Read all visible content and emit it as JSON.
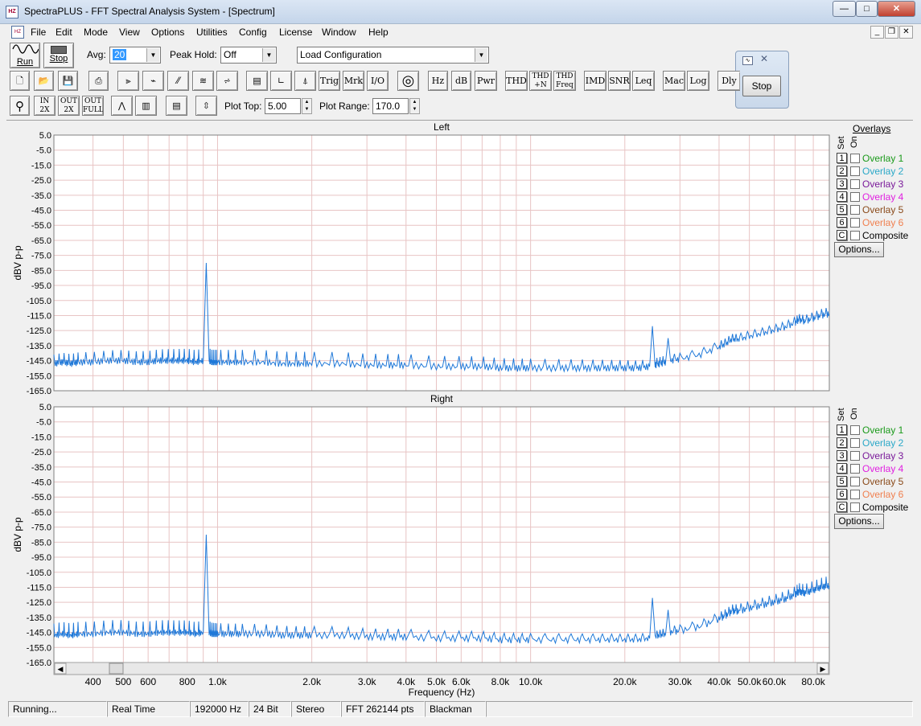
{
  "window": {
    "title": "SpectraPLUS - FFT Spectral Analysis System - [Spectrum]",
    "app_icon_text": "HZ"
  },
  "caption_buttons": {
    "minimize": "—",
    "maximize": "□",
    "close": "✕"
  },
  "menu": [
    "File",
    "Edit",
    "Mode",
    "View",
    "Options",
    "Utilities",
    "Config",
    "License",
    "Window",
    "Help"
  ],
  "mdi_buttons": {
    "minimize": "_",
    "restore": "❐",
    "close": "✕"
  },
  "toolbar1": {
    "run_label": "Run",
    "stop_label": "Stop",
    "avg_label": "Avg:",
    "avg_value": "20",
    "peak_hold_label": "Peak Hold:",
    "peak_hold_value": "Off",
    "config_value": "Load Configuration"
  },
  "toolbar2": [
    "Trig",
    "Mrk",
    "I/O",
    "Hz",
    "dB",
    "Pwr",
    "THD",
    "THD +N",
    "THD Freq",
    "IMD",
    "SNR",
    "Leq",
    "Mac",
    "Log",
    "Dly"
  ],
  "toolbar3": {
    "zoom_in_label": "IN 2X",
    "zoom_out_label": "OUT 2X",
    "zoom_full_label": "OUT FULL",
    "plot_top_label": "Plot Top:",
    "plot_top_value": "5.00",
    "plot_range_label": "Plot Range:",
    "plot_range_value": "170.0"
  },
  "stop_window": {
    "button_label": "Stop"
  },
  "overlays": {
    "header": "Overlays",
    "set_label": "Set",
    "on_label": "On",
    "items": [
      {
        "set": "1",
        "label": "Overlay 1",
        "color": "#1a9a1a"
      },
      {
        "set": "2",
        "label": "Overlay 2",
        "color": "#2aa8c8"
      },
      {
        "set": "3",
        "label": "Overlay 3",
        "color": "#7a1a9a"
      },
      {
        "set": "4",
        "label": "Overlay 4",
        "color": "#e020e0"
      },
      {
        "set": "5",
        "label": "Overlay 5",
        "color": "#8a4a1a"
      },
      {
        "set": "6",
        "label": "Overlay 6",
        "color": "#f08050"
      },
      {
        "set": "C",
        "label": "Composite",
        "color": "#000000"
      }
    ],
    "options_label": "Options..."
  },
  "chart_data": [
    {
      "type": "line",
      "title": "Left",
      "ylabel": "dBV p-p",
      "xlabel": "",
      "xscale": "log",
      "xlim": [
        300,
        90000
      ],
      "ylim": [
        -165,
        5
      ],
      "yticks": [
        "5.0",
        "-5.0",
        "-15.0",
        "-25.0",
        "-35.0",
        "-45.0",
        "-55.0",
        "-65.0",
        "-75.0",
        "-85.0",
        "-95.0",
        "-105.0",
        "-115.0",
        "-125.0",
        "-135.0",
        "-145.0",
        "-155.0",
        "-165.0"
      ],
      "grid": true,
      "series_color": "#1f78d8",
      "series": [
        {
          "x": [
            300,
            320,
            340,
            360,
            400,
            450,
            500,
            550,
            600,
            650,
            700,
            750,
            800,
            850,
            900,
            920,
            940,
            960,
            980,
            1000,
            1100,
            1200,
            1400,
            1600,
            1800,
            2000,
            2500,
            3000,
            3500,
            4000,
            5000,
            6000,
            7000,
            8000,
            9000,
            10000,
            12000,
            14000,
            16000,
            18000,
            20000,
            22000,
            24000,
            24500,
            25000,
            26000,
            27000,
            27500,
            28000,
            30000,
            35000,
            40000,
            42000,
            44000,
            46000,
            50000,
            55000,
            60000,
            65000,
            70000,
            72000,
            75000,
            80000,
            85000,
            90000
          ],
          "y": [
            -147,
            -146,
            -147,
            -146,
            -146,
            -145,
            -145,
            -146,
            -146,
            -145,
            -145,
            -145,
            -145,
            -146,
            -145,
            -80,
            -145,
            -146,
            -146,
            -146,
            -146,
            -146,
            -146,
            -147,
            -147,
            -147,
            -147,
            -148,
            -148,
            -148,
            -149,
            -149,
            -149,
            -150,
            -150,
            -150,
            -150,
            -150,
            -150,
            -150,
            -150,
            -150,
            -149,
            -122,
            -148,
            -147,
            -146,
            -130,
            -145,
            -144,
            -141,
            -136,
            -134,
            -131,
            -131,
            -129,
            -127,
            -125,
            -123,
            -120,
            -118,
            -119,
            -117,
            -115,
            -114
          ]
        }
      ]
    },
    {
      "type": "line",
      "title": "Right",
      "ylabel": "dBV p-p",
      "xlabel": "Frequency (Hz)",
      "xscale": "log",
      "xlim": [
        300,
        90000
      ],
      "ylim": [
        -165,
        5
      ],
      "yticks": [
        "5.0",
        "-5.0",
        "-15.0",
        "-25.0",
        "-35.0",
        "-45.0",
        "-55.0",
        "-65.0",
        "-75.0",
        "-85.0",
        "-95.0",
        "-105.0",
        "-115.0",
        "-125.0",
        "-135.0",
        "-145.0",
        "-155.0",
        "-165.0"
      ],
      "xticks": [
        {
          "v": 400,
          "t": "400"
        },
        {
          "v": 500,
          "t": "500"
        },
        {
          "v": 600,
          "t": "600"
        },
        {
          "v": 800,
          "t": "800"
        },
        {
          "v": 1000,
          "t": "1.0k"
        },
        {
          "v": 2000,
          "t": "2.0k"
        },
        {
          "v": 3000,
          "t": "3.0k"
        },
        {
          "v": 4000,
          "t": "4.0k"
        },
        {
          "v": 5000,
          "t": "5.0k"
        },
        {
          "v": 6000,
          "t": "6.0k"
        },
        {
          "v": 8000,
          "t": "8.0k"
        },
        {
          "v": 10000,
          "t": "10.0k"
        },
        {
          "v": 20000,
          "t": "20.0k"
        },
        {
          "v": 30000,
          "t": "30.0k"
        },
        {
          "v": 40000,
          "t": "40.0k"
        },
        {
          "v": 50000,
          "t": "50.0k"
        },
        {
          "v": 60000,
          "t": "60.0k"
        },
        {
          "v": 80000,
          "t": "80.0k"
        }
      ],
      "grid": true,
      "series_color": "#1f78d8",
      "series": [
        {
          "x": [
            300,
            320,
            340,
            360,
            400,
            450,
            500,
            550,
            600,
            650,
            700,
            750,
            800,
            850,
            900,
            920,
            940,
            960,
            980,
            1000,
            1100,
            1200,
            1400,
            1600,
            1800,
            2000,
            2500,
            3000,
            3500,
            4000,
            5000,
            6000,
            7000,
            8000,
            9000,
            10000,
            12000,
            14000,
            16000,
            18000,
            20000,
            22000,
            24000,
            24500,
            25000,
            26000,
            27000,
            27500,
            28000,
            30000,
            35000,
            40000,
            42000,
            44000,
            46000,
            50000,
            55000,
            60000,
            65000,
            70000,
            72000,
            75000,
            80000,
            85000,
            90000
          ],
          "y": [
            -147,
            -146,
            -147,
            -146,
            -146,
            -145,
            -145,
            -146,
            -146,
            -145,
            -145,
            -145,
            -145,
            -146,
            -145,
            -80,
            -145,
            -146,
            -146,
            -146,
            -146,
            -146,
            -146,
            -147,
            -147,
            -147,
            -147,
            -148,
            -148,
            -148,
            -149,
            -149,
            -149,
            -150,
            -150,
            -150,
            -150,
            -150,
            -150,
            -150,
            -150,
            -150,
            -149,
            -122,
            -148,
            -147,
            -146,
            -130,
            -145,
            -144,
            -141,
            -136,
            -134,
            -131,
            -131,
            -129,
            -127,
            -125,
            -123,
            -120,
            -118,
            -119,
            -117,
            -115,
            -114
          ]
        }
      ]
    }
  ],
  "statusbar": [
    "Running...",
    "Real Time",
    "192000 Hz",
    "24 Bit",
    "Stereo",
    "FFT 262144 pts",
    "Blackman"
  ]
}
